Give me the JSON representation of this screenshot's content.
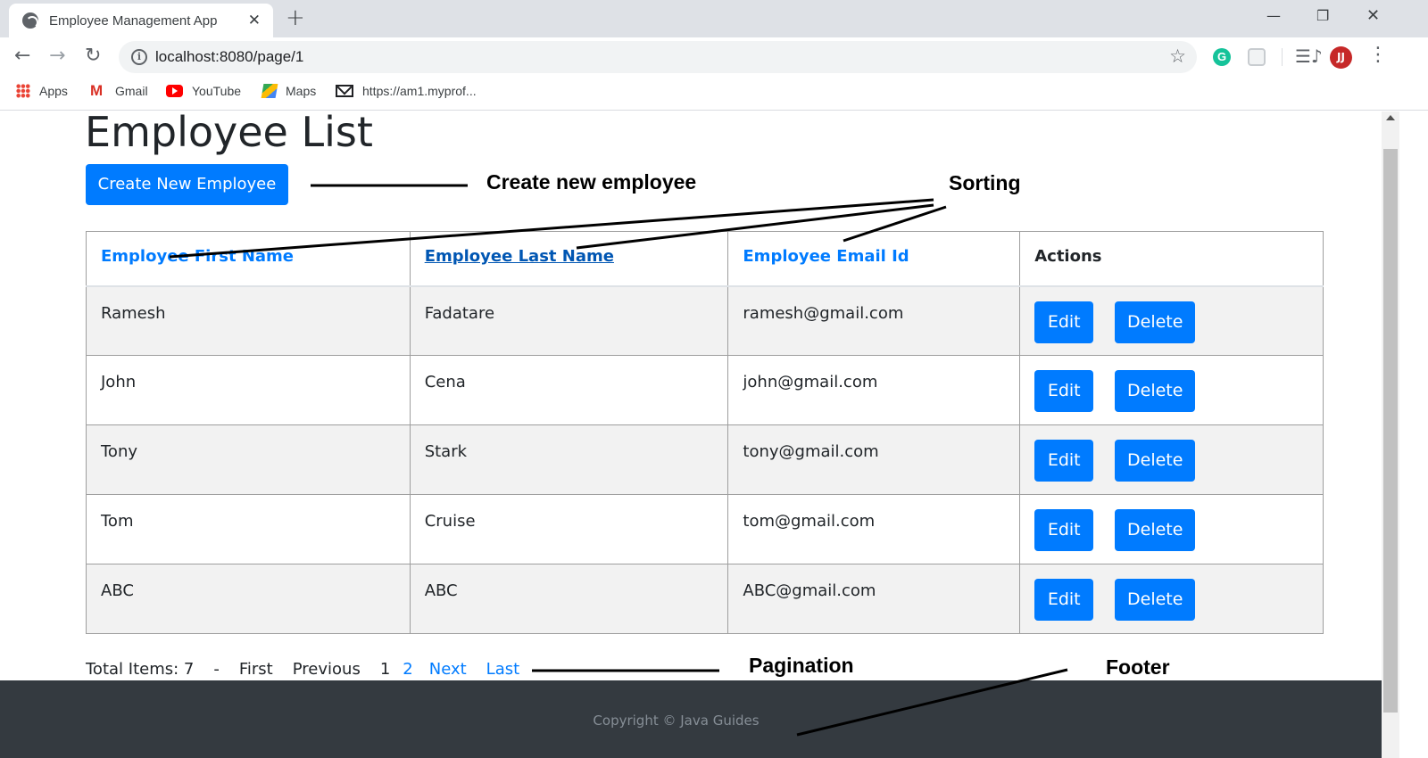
{
  "browser": {
    "tab_title": "Employee Management App",
    "tab_close": "✕",
    "new_tab": "+",
    "window_minimize": "—",
    "window_restore": "❐",
    "window_close": "✕",
    "nav_back": "←",
    "nav_forward": "→",
    "nav_reload": "↻",
    "url": "localhost:8080/page/1",
    "info_icon": "i",
    "star_icon": "☆",
    "menu_icon": "⋮",
    "media_icon": "☰♪",
    "grammarly": "G",
    "avatar": "JJ",
    "bookmarks": [
      {
        "label": "Apps",
        "icon": "apps-grid-icon"
      },
      {
        "label": "Gmail",
        "icon": "gmail-icon"
      },
      {
        "label": "YouTube",
        "icon": "youtube-icon"
      },
      {
        "label": "Maps",
        "icon": "maps-icon"
      },
      {
        "label": "https://am1.myprof...",
        "icon": "mail-envelope-icon"
      }
    ]
  },
  "page": {
    "title": "Employee List",
    "create_button": "Create New Employee",
    "table": {
      "headers": [
        "Employee First Name",
        "Employee Last Name",
        "Employee Email Id",
        "Actions"
      ],
      "rows": [
        [
          "Ramesh",
          "Fadatare",
          "ramesh@gmail.com"
        ],
        [
          "John",
          "Cena",
          "john@gmail.com"
        ],
        [
          "Tony",
          "Stark",
          "tony@gmail.com"
        ],
        [
          "Tom",
          "Cruise",
          "tom@gmail.com"
        ],
        [
          "ABC",
          "ABC",
          "ABC@gmail.com"
        ]
      ],
      "edit_label": "Edit",
      "delete_label": "Delete"
    },
    "pagination": {
      "total": "Total Items: 7",
      "separator": "-",
      "first": "First",
      "previous": "Previous",
      "page1": "1",
      "page2": "2",
      "next": "Next",
      "last": "Last"
    },
    "footer": "Copyright © Java Guides"
  },
  "annotations": {
    "create": "Create new employee",
    "sorting": "Sorting",
    "pagination": "Pagination",
    "footer": "Footer"
  },
  "colors": {
    "primary": "#007bff",
    "footer_bg": "#343a40",
    "row_stripe": "#f2f2f2"
  }
}
